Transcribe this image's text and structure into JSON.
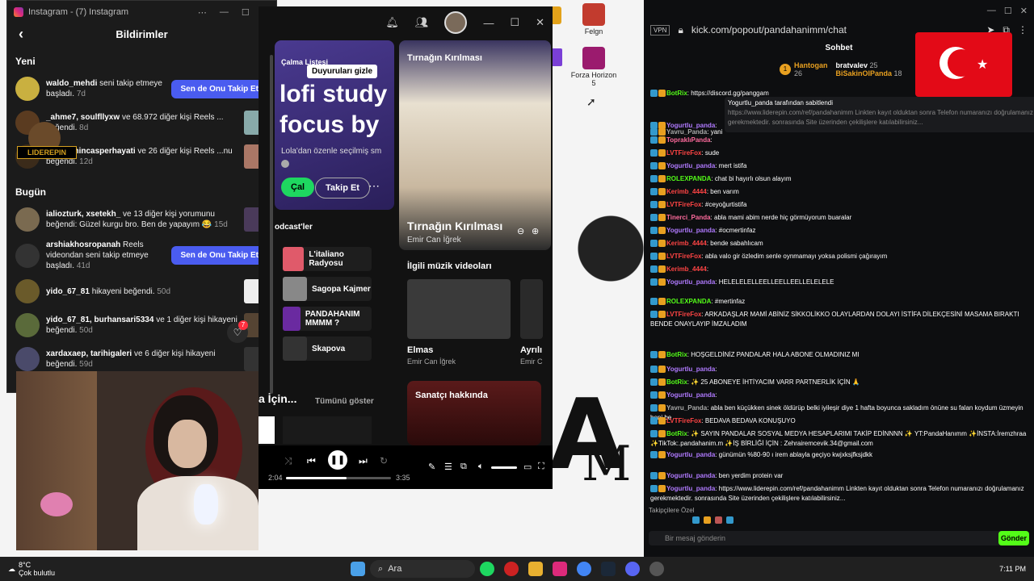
{
  "desktop": {
    "icons": [
      {
        "label": "Felgn"
      },
      {
        "label": "Forza Horizon 5"
      }
    ]
  },
  "instagram": {
    "window_title": "Instagram - (7) Instagram",
    "header": "Bildirimler",
    "section_new": "Yeni",
    "section_today": "Bugün",
    "notifications": [
      {
        "user": "waldo_mehdi",
        "text": "seni takip etmeye başladı.",
        "time": "7d",
        "button": "Sen de Onu Takip Et"
      },
      {
        "user": "_ahme7, soulfllyxw",
        "text": "ve 68.972 diğer kişi Reels ... beğendi.",
        "time": "8d"
      },
      {
        "user": "...4, erenincasperhayati",
        "text": "ve 26 diğer kişi Reels ...nu beğendi.",
        "time": "12d"
      },
      {
        "user": "ialiozturk, xsetekh_",
        "text": "ve 13 diğer kişi yorumunu beğendi: Güzel kurgu bro. Ben de yapayım 😂",
        "time": "15d"
      },
      {
        "user": "arshiakhosropanah",
        "text": "Reels videondan seni takip etmeye başladı.",
        "time": "41d",
        "button": "Sen de Onu Takip Et"
      },
      {
        "user": "yido_67_81",
        "text": "hikayeni beğendi.",
        "time": "50d"
      },
      {
        "user": "yido_67_81, burhansari5334",
        "text": "ve 1 diğer kişi hikayeni beğendi.",
        "time": "50d"
      },
      {
        "user": "xardaxaep, tarihigaleri",
        "text": "ve 6 diğer kişi hikayeni beğendi.",
        "time": "59d"
      }
    ],
    "badge_count": "7",
    "logo_text": "LIDEREPIN"
  },
  "spotify": {
    "playlist_label": "Çalma Listesi",
    "tooltip": "Duyuruları gizle",
    "playlist_title": "lofi study focus by l",
    "playlist_desc": "Lola'dan özenle seçilmiş sm",
    "play_label": "Çal",
    "follow_label": "Takip Et",
    "podcasts_label": "odcast'ler",
    "podcasts": [
      "L'italiano Radyosu",
      "Sagopa Kajmer",
      "PANDAHANIM MMMM ?",
      "Skapova"
    ],
    "for_you": "a İçin...",
    "show_all": "Tümünü göster",
    "now_playing_card_title": "Tırnağın Kırılması",
    "track_title": "Tırnağın Kırılması",
    "artist": "Emir Can İğrek",
    "videos_label": "İlgili müzik videoları",
    "video1_title": "Elmas",
    "video1_artist": "Emir Can İğrek",
    "video2_title": "Ayrılı",
    "video2_artist": "Emir C",
    "about_artist": "Sanatçı hakkında",
    "time_elapsed": "2:04",
    "time_total": "3:35",
    "progress": 0.58
  },
  "chat": {
    "url": "kick.com/popout/pandahanimm/chat",
    "vpn": "VPN",
    "header": "Sohbet",
    "top_gifters": [
      {
        "name": "Hantogan",
        "count": "26"
      },
      {
        "name": "bratvalev",
        "count": "25"
      },
      {
        "name": "BiSakinOlPanda",
        "count": "18"
      }
    ],
    "pinned_by": "Yogurtlu_panda tarafından sabitlendi",
    "pinned_text": "https://www.liderepin.com/ref/pandahanimm Linkten kayıt olduktan sonra Telefon numaranızı doğrulamanız gerekmektedir. sonrasında Site üzerinden çekilişlere katılabilirsiniz...",
    "messages": [
      {
        "user": "BotRix",
        "color": "#53fc18",
        "text": "https://discord.gg/panggam"
      },
      {
        "user": "Yogurtlu_panda",
        "color": "#b07aff",
        "text": ""
      },
      {
        "user": "Yavru_Panda",
        "color": "#aaa",
        "text": "yani"
      },
      {
        "user": "TopraklıPanda",
        "color": "#ff6b9d",
        "text": ""
      },
      {
        "user": "LVTFireFox",
        "color": "#ff4444",
        "text": "sude"
      },
      {
        "user": "Yogurtlu_panda",
        "color": "#b07aff",
        "text": "mert istifa"
      },
      {
        "user": "ROLEXPANDA",
        "color": "#53fc18",
        "text": "chat bi hayırlı olsun alayım"
      },
      {
        "user": "Kerimb_4444",
        "color": "#ff4444",
        "text": "ben varım"
      },
      {
        "user": "LVTFireFox",
        "color": "#ff4444",
        "text": "#ceyoğurtistifa"
      },
      {
        "user": "Tinerci_Panda",
        "color": "#ff6b9d",
        "text": "abla mami abim nerde hiç görmüyorum buaralar"
      },
      {
        "user": "Yogurtlu_panda",
        "color": "#b07aff",
        "text": "#ocmertinfaz"
      },
      {
        "user": "Kerimb_4444",
        "color": "#ff4444",
        "text": "bende sabahlıcam"
      },
      {
        "user": "LVTFireFox",
        "color": "#ff4444",
        "text": "abla valo gir özledim senle oynmamayı yoksa polismi çağırayım"
      },
      {
        "user": "Kerimb_4444",
        "color": "#ff4444",
        "text": ""
      },
      {
        "user": "Yogurtlu_panda",
        "color": "#b07aff",
        "text": "HELELELELLEELLEELLEELLELELELE"
      },
      {
        "user": "ROLEXPANDA",
        "color": "#53fc18",
        "text": "#mertinfaz"
      },
      {
        "user": "LVTFireFox",
        "color": "#ff4444",
        "text": "ARKADAŞLAR MAMİ ABİNİZ SİKKOLİKKO OLAYLARDAN DOLAYI İSTİFA DİLEKÇESİNİ MASAMA BIRAKTI BENDE ONAYLAYIP İMZALADIM"
      },
      {
        "user": "BotRix",
        "color": "#53fc18",
        "text": "HOŞGELDİNİZ PANDALAR HALA ABONE OLMADINIZ MI"
      },
      {
        "user": "Yogurtlu_panda",
        "color": "#b07aff",
        "text": ""
      },
      {
        "user": "BotRix",
        "color": "#53fc18",
        "text": "✨ 25 ABONEYE İHTİYACIM VARR PARTNERLİK İÇİN 🙏"
      },
      {
        "user": "Yogurtlu_panda",
        "color": "#b07aff",
        "text": ""
      },
      {
        "user": "Yavru_Panda",
        "color": "#aaa",
        "text": "abla ben küçükken sinek öldürüp belki iyileşir diye 1 hafta boyunca sakladım önüne su falan koydum üzmeyin beni be"
      },
      {
        "user": "LVTFireFox",
        "color": "#ff4444",
        "text": "BEDAVA BEDAVA KONUŞUYO"
      },
      {
        "user": "BotRix",
        "color": "#53fc18",
        "text": "✨ SAYIN PANDALAR SOSYAL MEDYA HESAPLARIMI TAKİP EDİNNNN ✨ YT:PandaHanımm ✨İNSTA:İremzhraa ✨TikTok:.pandahanim.m ✨İŞ BİRLİĞİ İÇİN : Zehrairemcevik.34@gmail.com"
      },
      {
        "user": "Yogurtlu_panda",
        "color": "#b07aff",
        "text": "günümün %80-90 ı irem ablayla geçiyo kwjxksjfksjdkk"
      },
      {
        "user": "Yogurtlu_panda",
        "color": "#b07aff",
        "text": "ben yerdim protein var"
      },
      {
        "user": "Yogurtlu_panda",
        "color": "#b07aff",
        "text": "https://www.liderepin.com/ref/pandahanimm Linkten kayıt olduktan sonra Telefon numaranızı doğrulamanız gerekmektedir. sonrasında Site üzerinden çekilişlere katılabilirsiniz..."
      }
    ],
    "emote_label": "Takipçilere Özel",
    "input_placeholder": "Bir mesaj gönderin",
    "send_label": "Gönder"
  },
  "taskbar": {
    "weather_temp": "8°C",
    "weather_desc": "Çok bulutlu",
    "search_label": "Ara",
    "time": "7:11 PM"
  }
}
